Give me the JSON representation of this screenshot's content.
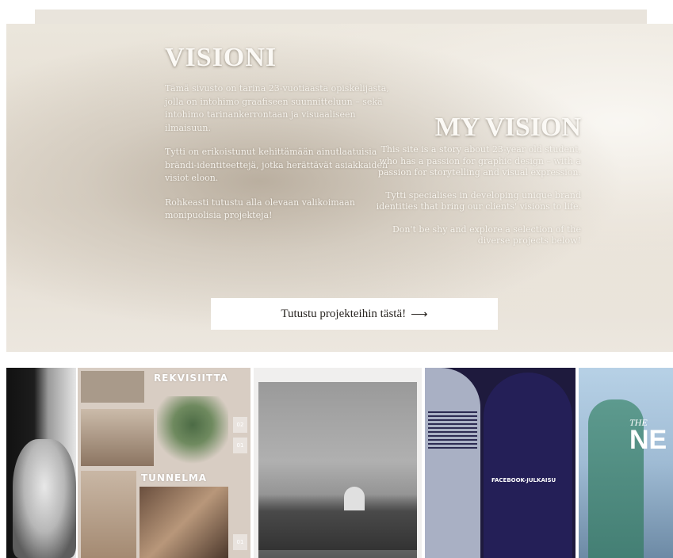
{
  "hero": {
    "fi": {
      "title": "VISIONI",
      "paragraphs": [
        "Tämä sivusto on tarina 23-vuotiaasta opiskelijasta, jolla on intohimo graafiseen suunnitteluun – sekä intohimo tarinankerrontaan ja visuaaliseen ilmaisuun.",
        "Tytti on erikoistunut kehittämään ainutlaatuisia brändi-identiteettejä, jotka herättävät asiakkaiden visiot eloon.",
        "Rohkeasti tutustu alla olevaan valikoimaan monipuolisia projekteja!"
      ]
    },
    "en": {
      "title": "MY VISION",
      "paragraphs": [
        "This site is a story about 23-year old student, who has a passion for graphic design – with a passion for storytelling and visual expression.",
        "Tytti specialises in developing unique brand identities that bring our clients' visions to life.",
        "Don't be shy and explore a selection of the diverse projects below!"
      ]
    },
    "cta_label": "Tutustu projekteihin tästä!",
    "cta_arrow": "⟶"
  },
  "gallery": {
    "item2": {
      "label_top": "REKVISIITTA",
      "label_bottom": "TUNNELMA",
      "nums": [
        "02",
        "01",
        "01"
      ]
    },
    "item4": {
      "label": "FACEBOOK-JULKAISU"
    },
    "item5": {
      "the": "THE",
      "big": "NE"
    }
  },
  "colors": {
    "hero_bg": "#e6dfd4",
    "cta_bg": "#ffffff",
    "dark_navy": "#1e1a3d"
  }
}
